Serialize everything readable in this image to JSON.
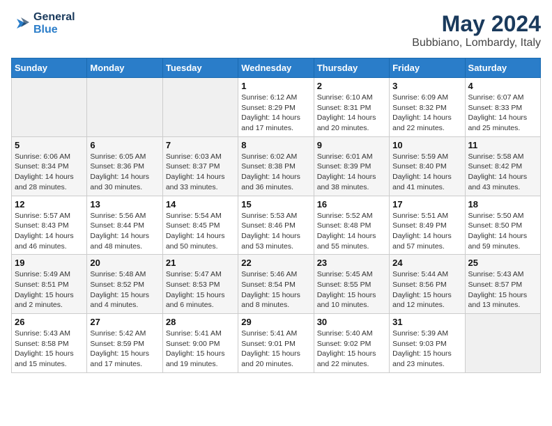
{
  "logo": {
    "line1": "General",
    "line2": "Blue"
  },
  "title": "May 2024",
  "subtitle": "Bubbiano, Lombardy, Italy",
  "days_of_week": [
    "Sunday",
    "Monday",
    "Tuesday",
    "Wednesday",
    "Thursday",
    "Friday",
    "Saturday"
  ],
  "weeks": [
    [
      {
        "day": "",
        "info": ""
      },
      {
        "day": "",
        "info": ""
      },
      {
        "day": "",
        "info": ""
      },
      {
        "day": "1",
        "info": "Sunrise: 6:12 AM\nSunset: 8:29 PM\nDaylight: 14 hours\nand 17 minutes."
      },
      {
        "day": "2",
        "info": "Sunrise: 6:10 AM\nSunset: 8:31 PM\nDaylight: 14 hours\nand 20 minutes."
      },
      {
        "day": "3",
        "info": "Sunrise: 6:09 AM\nSunset: 8:32 PM\nDaylight: 14 hours\nand 22 minutes."
      },
      {
        "day": "4",
        "info": "Sunrise: 6:07 AM\nSunset: 8:33 PM\nDaylight: 14 hours\nand 25 minutes."
      }
    ],
    [
      {
        "day": "5",
        "info": "Sunrise: 6:06 AM\nSunset: 8:34 PM\nDaylight: 14 hours\nand 28 minutes."
      },
      {
        "day": "6",
        "info": "Sunrise: 6:05 AM\nSunset: 8:36 PM\nDaylight: 14 hours\nand 30 minutes."
      },
      {
        "day": "7",
        "info": "Sunrise: 6:03 AM\nSunset: 8:37 PM\nDaylight: 14 hours\nand 33 minutes."
      },
      {
        "day": "8",
        "info": "Sunrise: 6:02 AM\nSunset: 8:38 PM\nDaylight: 14 hours\nand 36 minutes."
      },
      {
        "day": "9",
        "info": "Sunrise: 6:01 AM\nSunset: 8:39 PM\nDaylight: 14 hours\nand 38 minutes."
      },
      {
        "day": "10",
        "info": "Sunrise: 5:59 AM\nSunset: 8:40 PM\nDaylight: 14 hours\nand 41 minutes."
      },
      {
        "day": "11",
        "info": "Sunrise: 5:58 AM\nSunset: 8:42 PM\nDaylight: 14 hours\nand 43 minutes."
      }
    ],
    [
      {
        "day": "12",
        "info": "Sunrise: 5:57 AM\nSunset: 8:43 PM\nDaylight: 14 hours\nand 46 minutes."
      },
      {
        "day": "13",
        "info": "Sunrise: 5:56 AM\nSunset: 8:44 PM\nDaylight: 14 hours\nand 48 minutes."
      },
      {
        "day": "14",
        "info": "Sunrise: 5:54 AM\nSunset: 8:45 PM\nDaylight: 14 hours\nand 50 minutes."
      },
      {
        "day": "15",
        "info": "Sunrise: 5:53 AM\nSunset: 8:46 PM\nDaylight: 14 hours\nand 53 minutes."
      },
      {
        "day": "16",
        "info": "Sunrise: 5:52 AM\nSunset: 8:48 PM\nDaylight: 14 hours\nand 55 minutes."
      },
      {
        "day": "17",
        "info": "Sunrise: 5:51 AM\nSunset: 8:49 PM\nDaylight: 14 hours\nand 57 minutes."
      },
      {
        "day": "18",
        "info": "Sunrise: 5:50 AM\nSunset: 8:50 PM\nDaylight: 14 hours\nand 59 minutes."
      }
    ],
    [
      {
        "day": "19",
        "info": "Sunrise: 5:49 AM\nSunset: 8:51 PM\nDaylight: 15 hours\nand 2 minutes."
      },
      {
        "day": "20",
        "info": "Sunrise: 5:48 AM\nSunset: 8:52 PM\nDaylight: 15 hours\nand 4 minutes."
      },
      {
        "day": "21",
        "info": "Sunrise: 5:47 AM\nSunset: 8:53 PM\nDaylight: 15 hours\nand 6 minutes."
      },
      {
        "day": "22",
        "info": "Sunrise: 5:46 AM\nSunset: 8:54 PM\nDaylight: 15 hours\nand 8 minutes."
      },
      {
        "day": "23",
        "info": "Sunrise: 5:45 AM\nSunset: 8:55 PM\nDaylight: 15 hours\nand 10 minutes."
      },
      {
        "day": "24",
        "info": "Sunrise: 5:44 AM\nSunset: 8:56 PM\nDaylight: 15 hours\nand 12 minutes."
      },
      {
        "day": "25",
        "info": "Sunrise: 5:43 AM\nSunset: 8:57 PM\nDaylight: 15 hours\nand 13 minutes."
      }
    ],
    [
      {
        "day": "26",
        "info": "Sunrise: 5:43 AM\nSunset: 8:58 PM\nDaylight: 15 hours\nand 15 minutes."
      },
      {
        "day": "27",
        "info": "Sunrise: 5:42 AM\nSunset: 8:59 PM\nDaylight: 15 hours\nand 17 minutes."
      },
      {
        "day": "28",
        "info": "Sunrise: 5:41 AM\nSunset: 9:00 PM\nDaylight: 15 hours\nand 19 minutes."
      },
      {
        "day": "29",
        "info": "Sunrise: 5:41 AM\nSunset: 9:01 PM\nDaylight: 15 hours\nand 20 minutes."
      },
      {
        "day": "30",
        "info": "Sunrise: 5:40 AM\nSunset: 9:02 PM\nDaylight: 15 hours\nand 22 minutes."
      },
      {
        "day": "31",
        "info": "Sunrise: 5:39 AM\nSunset: 9:03 PM\nDaylight: 15 hours\nand 23 minutes."
      },
      {
        "day": "",
        "info": ""
      }
    ]
  ]
}
